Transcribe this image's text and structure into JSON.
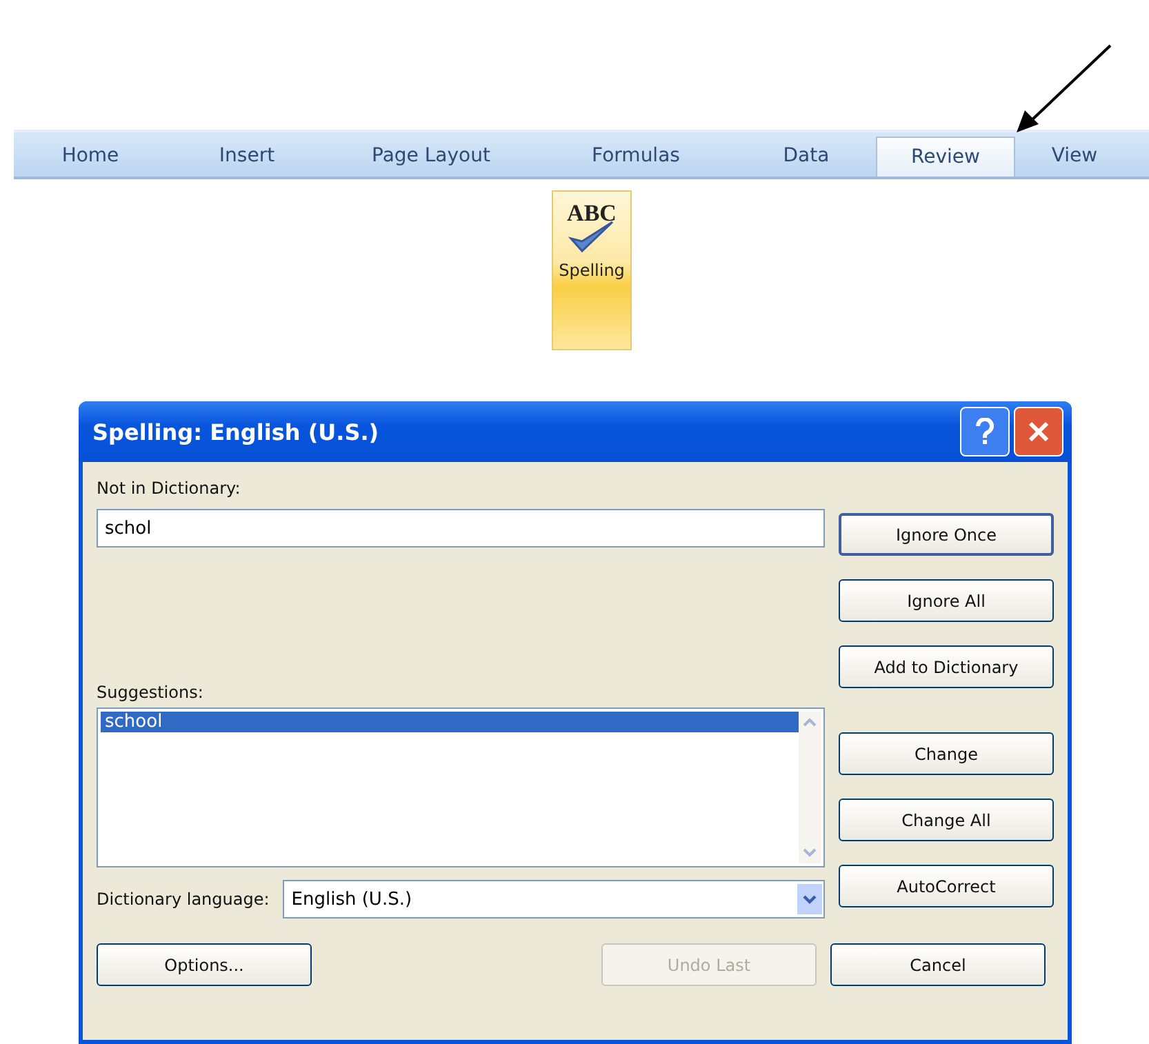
{
  "ribbon": {
    "tabs": [
      {
        "label": "Home",
        "selected": false
      },
      {
        "label": "Insert",
        "selected": false
      },
      {
        "label": "Page Layout",
        "selected": false
      },
      {
        "label": "Formulas",
        "selected": false
      },
      {
        "label": "Data",
        "selected": false
      },
      {
        "label": "Review",
        "selected": true
      },
      {
        "label": "View",
        "selected": false
      }
    ],
    "spelling_button": {
      "icon_text": "ABC",
      "label": "Spelling"
    }
  },
  "dialog": {
    "title": "Spelling: English (U.S.)",
    "not_in_dictionary": {
      "label": "Not in Dictionary:",
      "value": "schol"
    },
    "suggestions": {
      "label": "Suggestions:",
      "items": [
        {
          "text": "school",
          "selected": true
        }
      ]
    },
    "dictionary_language": {
      "label": "Dictionary language:",
      "value": "English (U.S.)"
    },
    "side_buttons": [
      {
        "label": "Ignore Once",
        "default": true
      },
      {
        "label": "Ignore All",
        "default": false
      },
      {
        "label": "Add to Dictionary",
        "default": false
      }
    ],
    "change_buttons": [
      {
        "label": "Change",
        "default": false
      },
      {
        "label": "Change All",
        "default": false
      },
      {
        "label": "AutoCorrect",
        "default": false
      }
    ],
    "bottom_buttons": [
      {
        "label": "Options...",
        "disabled": false
      },
      {
        "label": "Undo Last",
        "disabled": true
      },
      {
        "label": "Cancel",
        "disabled": false
      }
    ]
  }
}
